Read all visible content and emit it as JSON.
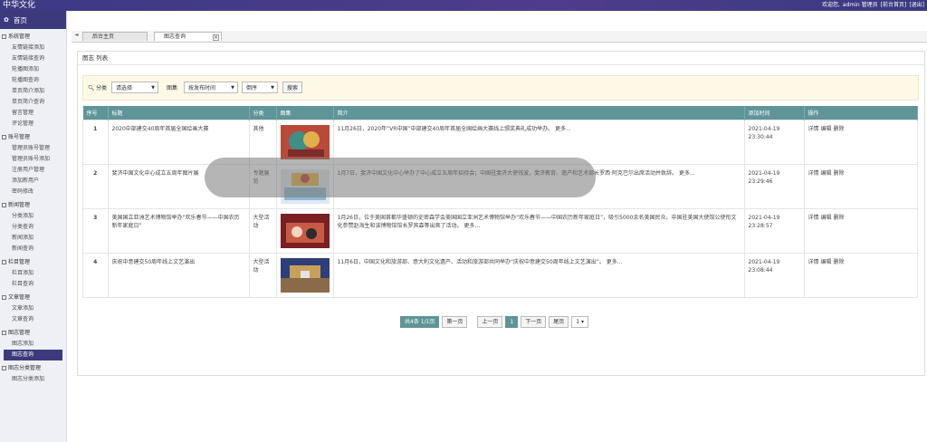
{
  "app_title": "中华文化",
  "topbar": {
    "welcome": "欢迎您,",
    "user": "admin 管理员",
    "links": [
      "[前台首页]",
      "[退出]"
    ]
  },
  "sidebar": {
    "home_label": "首页",
    "groups": [
      {
        "title": "系统管理",
        "items": [
          "友情链接添加",
          "友情链接查询",
          "轮播图添加",
          "轮播图查询",
          "单页简介添加",
          "单页简介查询",
          "留言管理",
          "评论管理"
        ]
      },
      {
        "title": "账号管理",
        "items": [
          "管理员账号管理",
          "管理员账号添加",
          "注册用户管理",
          "添加新用户",
          "密码修改"
        ]
      },
      {
        "title": "新闻管理",
        "items": [
          "分类添加",
          "分类查询",
          "新闻添加",
          "新闻查询"
        ]
      },
      {
        "title": "栏目管理",
        "items": [
          "栏目添加",
          "栏目查询"
        ]
      },
      {
        "title": "文章管理",
        "items": [
          "文章添加",
          "文章查询"
        ]
      },
      {
        "title": "图志管理",
        "items": [
          "图志添加",
          "图志查询"
        ]
      },
      {
        "title": "图志分类管理",
        "items": [
          "图志分类添加"
        ]
      }
    ],
    "active_item": "图志查询"
  },
  "tabs": [
    {
      "label": "后台主页"
    },
    {
      "label": "图志查询",
      "close": "×"
    }
  ],
  "panel": {
    "title": "图志 列表"
  },
  "filter": {
    "category_label": "分类",
    "category_value": "请选择",
    "gallery_label": "图集",
    "sort_value": "按发布时间",
    "order_value": "倒序",
    "search_label": "搜索"
  },
  "table": {
    "headers": [
      "序号",
      "标题",
      "分类",
      "图集",
      "简介",
      "添加时间",
      "操作"
    ],
    "rows": [
      {
        "num": "1",
        "title": "2020中部建交40周年首届全国绘画大赛",
        "category": "其他",
        "intro": "11月26日，2020年“VR中国”中部建交40周年首届全国绘画大赛线上颁奖典礼成功举办。 更多...",
        "date": "2021-04-19",
        "time": "23:30:44"
      },
      {
        "num": "2",
        "title": "斐济中国文化中心成立五周年图片展",
        "category": "专题展览",
        "intro": "1月7日，斐济中国文化中心举办了中心成立五周年招待会；中国驻斐济大使钱波，斐济教育、遗产和艺术部长罗西·阿克巴尔出席活动并致辞。 更多...",
        "date": "2021-04-19",
        "time": "23:29:46"
      },
      {
        "num": "3",
        "title": "美国国立亚洲艺术博物馆举办“欢乐春节——中国农历新年家庭日”",
        "category": "大型活动",
        "intro": "1月26日，位于美国首都华盛顿的史密森学会美国国立亚洲艺术博物馆举办“欢乐春节——中国农历新年家庭日”，吸引5000余名美国民众。中国驻美国大使馆公使衔文化参赞赵海生和该博物馆馆长罗宾森等出席了活动。 更多...",
        "date": "2021-04-19",
        "time": "23:28:57"
      },
      {
        "num": "4",
        "title": "庆祝中意建交50周年线上文艺演出",
        "category": "大型活动",
        "intro": "11月6日，中国文化和旅游部、意大利文化遗产、活动和旅游部共同举办“庆祝中意建交50周年线上文艺演出”。 更多...",
        "date": "2021-04-19",
        "time": "23:08:44"
      }
    ],
    "ops": [
      "详情",
      "编辑",
      "删除"
    ]
  },
  "pager": {
    "total": "共4条 1/1页",
    "first": "第一页",
    "prev": "上一页",
    "current": "1",
    "next": "下一页",
    "last": "尾页",
    "jump_value": "1"
  },
  "colors": {
    "header_bg": "#3d3a85",
    "table_header": "#5f9598",
    "filter_bg": "#fdf9e6"
  }
}
